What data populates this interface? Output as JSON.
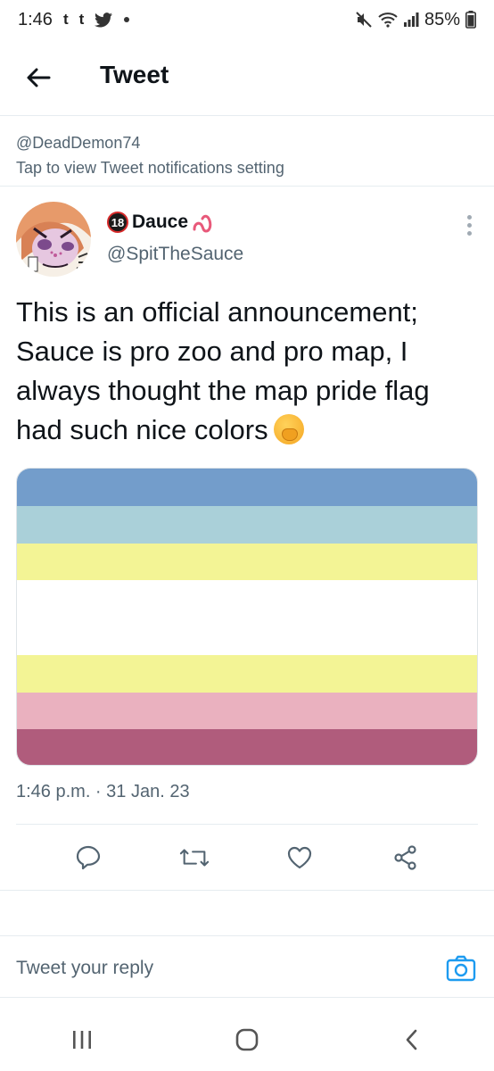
{
  "status_bar": {
    "time": "1:46",
    "notification_icons": [
      "t",
      "t"
    ],
    "battery": "85%",
    "icons": [
      "tumblr-icon",
      "tumblr-icon",
      "twitter-bird-icon",
      "dot-icon",
      "mute-icon",
      "wifi-icon",
      "signal-icon",
      "battery-icon"
    ]
  },
  "header": {
    "title": "Tweet"
  },
  "notif_banner": {
    "handle": "@DeadDemon74",
    "text": "Tap to view Tweet notifications setting"
  },
  "tweet": {
    "author": {
      "badge": "18",
      "display_name": "Dauce",
      "handle": "@SpitTheSauce"
    },
    "text": "This is an official announcement; Sauce is pro zoo and pro map, I always thought the map pride flag had such nice colors",
    "timestamp": "1:46 p.m. · 31 Jan. 23",
    "flag_colors": [
      "#739dcb",
      "#aad0d9",
      "#f3f495",
      "#ffffff",
      "#f3f495",
      "#eab1bf",
      "#b05c7c"
    ],
    "flag_stripe_weights": [
      1,
      1,
      1,
      2,
      1,
      1,
      1
    ]
  },
  "reply": {
    "placeholder": "Tweet your reply"
  },
  "colors": {
    "accent": "#1d9bf0",
    "muted": "#536471",
    "divider": "#e6ecf0"
  }
}
